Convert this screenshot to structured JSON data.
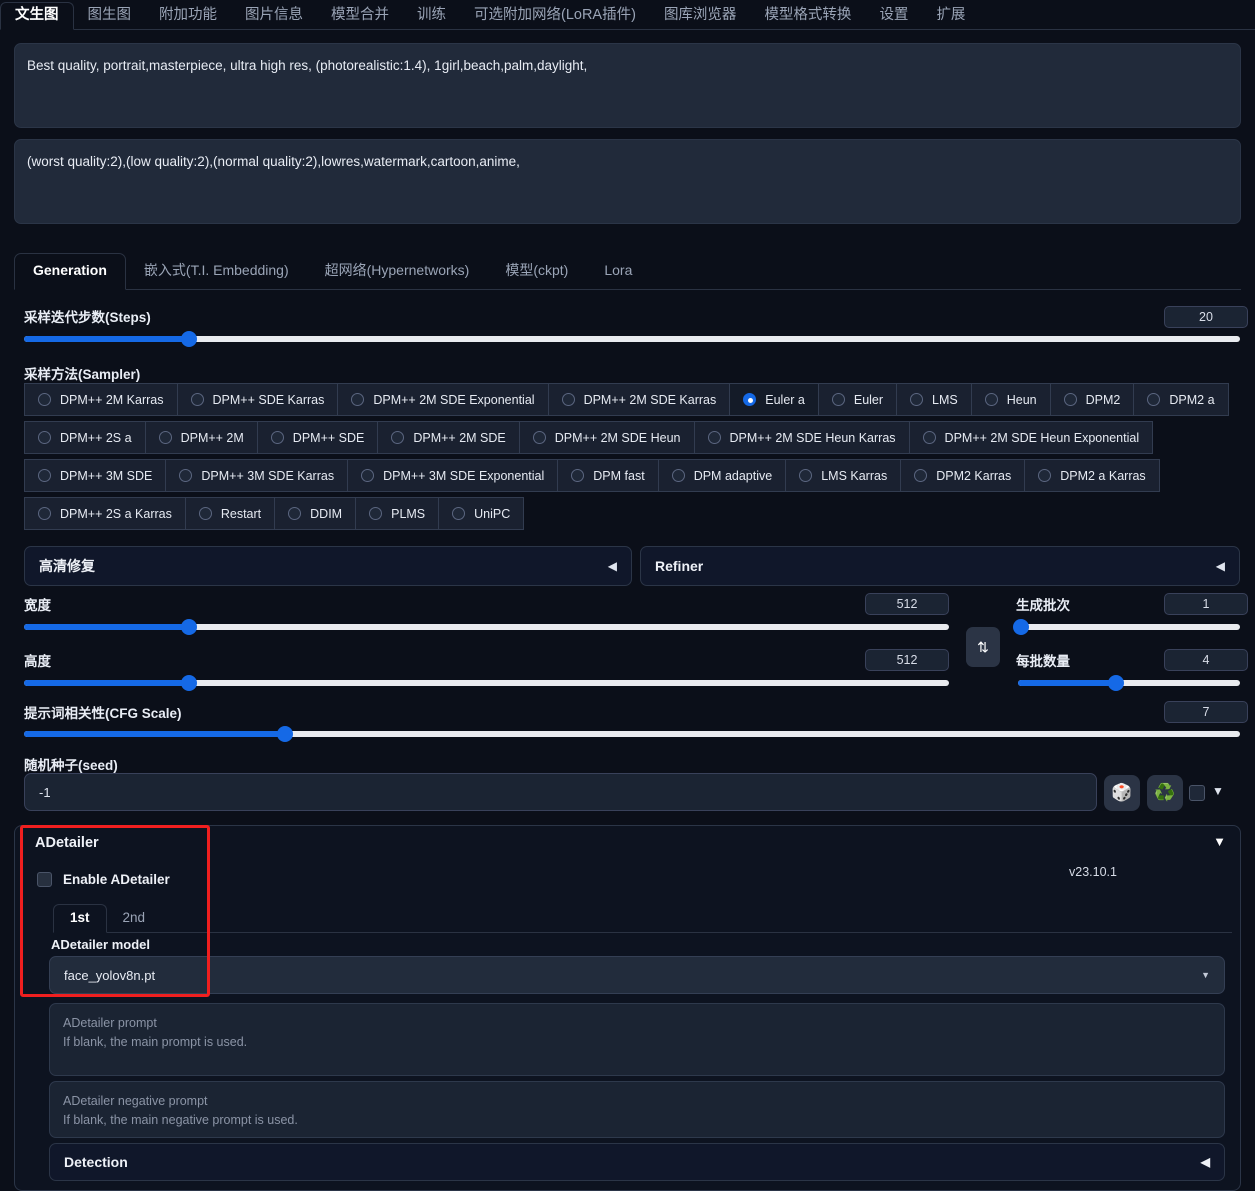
{
  "top_tabs": [
    {
      "label": "文生图",
      "active": true
    },
    {
      "label": "图生图",
      "active": false
    },
    {
      "label": "附加功能",
      "active": false
    },
    {
      "label": "图片信息",
      "active": false
    },
    {
      "label": "模型合并",
      "active": false
    },
    {
      "label": "训练",
      "active": false
    },
    {
      "label": "可选附加网络(LoRA插件)",
      "active": false
    },
    {
      "label": "图库浏览器",
      "active": false
    },
    {
      "label": "模型格式转换",
      "active": false
    },
    {
      "label": "设置",
      "active": false
    },
    {
      "label": "扩展",
      "active": false
    }
  ],
  "prompts": {
    "positive": "Best quality, portrait,masterpiece, ultra high res, (photorealistic:1.4), 1girl,beach,palm,daylight,",
    "negative": "(worst quality:2),(low quality:2),(normal quality:2),lowres,watermark,cartoon,anime,"
  },
  "sub_tabs": [
    {
      "label": "Generation",
      "active": true
    },
    {
      "label": "嵌入式(T.I. Embedding)",
      "active": false
    },
    {
      "label": "超网络(Hypernetworks)",
      "active": false
    },
    {
      "label": "模型(ckpt)",
      "active": false
    },
    {
      "label": "Lora",
      "active": false
    }
  ],
  "steps": {
    "label": "采样迭代步数(Steps)",
    "value": "20",
    "percent": 13.6
  },
  "sampler": {
    "label": "采样方法(Sampler)",
    "selected": "Euler a",
    "rows": [
      [
        "DPM++ 2M Karras",
        "DPM++ SDE Karras",
        "DPM++ 2M SDE Exponential",
        "DPM++ 2M SDE Karras",
        "Euler a",
        "Euler",
        "LMS",
        "Heun",
        "DPM2",
        "DPM2 a"
      ],
      [
        "DPM++ 2S a",
        "DPM++ 2M",
        "DPM++ SDE",
        "DPM++ 2M SDE",
        "DPM++ 2M SDE Heun",
        "DPM++ 2M SDE Heun Karras",
        "DPM++ 2M SDE Heun Exponential"
      ],
      [
        "DPM++ 3M SDE",
        "DPM++ 3M SDE Karras",
        "DPM++ 3M SDE Exponential",
        "DPM fast",
        "DPM adaptive",
        "LMS Karras",
        "DPM2 Karras",
        "DPM2 a Karras"
      ],
      [
        "DPM++ 2S a Karras",
        "Restart",
        "DDIM",
        "PLMS",
        "UniPC"
      ]
    ]
  },
  "accordions": {
    "hires_fix": "高清修复",
    "refiner": "Refiner",
    "arrow_glyph": "◀"
  },
  "width": {
    "label": "宽度",
    "value": "512",
    "percent": 17.8
  },
  "height": {
    "label": "高度",
    "value": "512",
    "percent": 17.8
  },
  "batch_count": {
    "label": "生成批次",
    "value": "1",
    "percent": 1.5
  },
  "batch_size": {
    "label": "每批数量",
    "value": "4",
    "percent": 44
  },
  "cfg_scale": {
    "label": "提示词相关性(CFG Scale)",
    "value": "7",
    "percent": 21.5
  },
  "seed": {
    "label": "随机种子(seed)",
    "value": "-1",
    "dice_icon": "🎲",
    "recycle_icon": "♻️",
    "caret_glyph": "▼"
  },
  "swap_button": {
    "icon": "⇅"
  },
  "adetailer": {
    "title": "ADetailer",
    "collapse_glyph": "▼",
    "version": "v23.10.1",
    "enable_label": "Enable ADetailer",
    "tabs": [
      {
        "label": "1st",
        "active": true
      },
      {
        "label": "2nd",
        "active": false
      }
    ],
    "model_label": "ADetailer model",
    "model_value": "face_yolov8n.pt",
    "model_caret": "▼",
    "prompt_placeholder_title": "ADetailer prompt",
    "prompt_placeholder_hint": "If blank, the main prompt is used.",
    "negative_placeholder_title": "ADetailer negative prompt",
    "negative_placeholder_hint": "If blank, the main negative prompt is used.",
    "detection_label": "Detection",
    "detection_arrow": "◀"
  },
  "highlight_color": "#f01f1f",
  "accent_color": "#1569e6"
}
